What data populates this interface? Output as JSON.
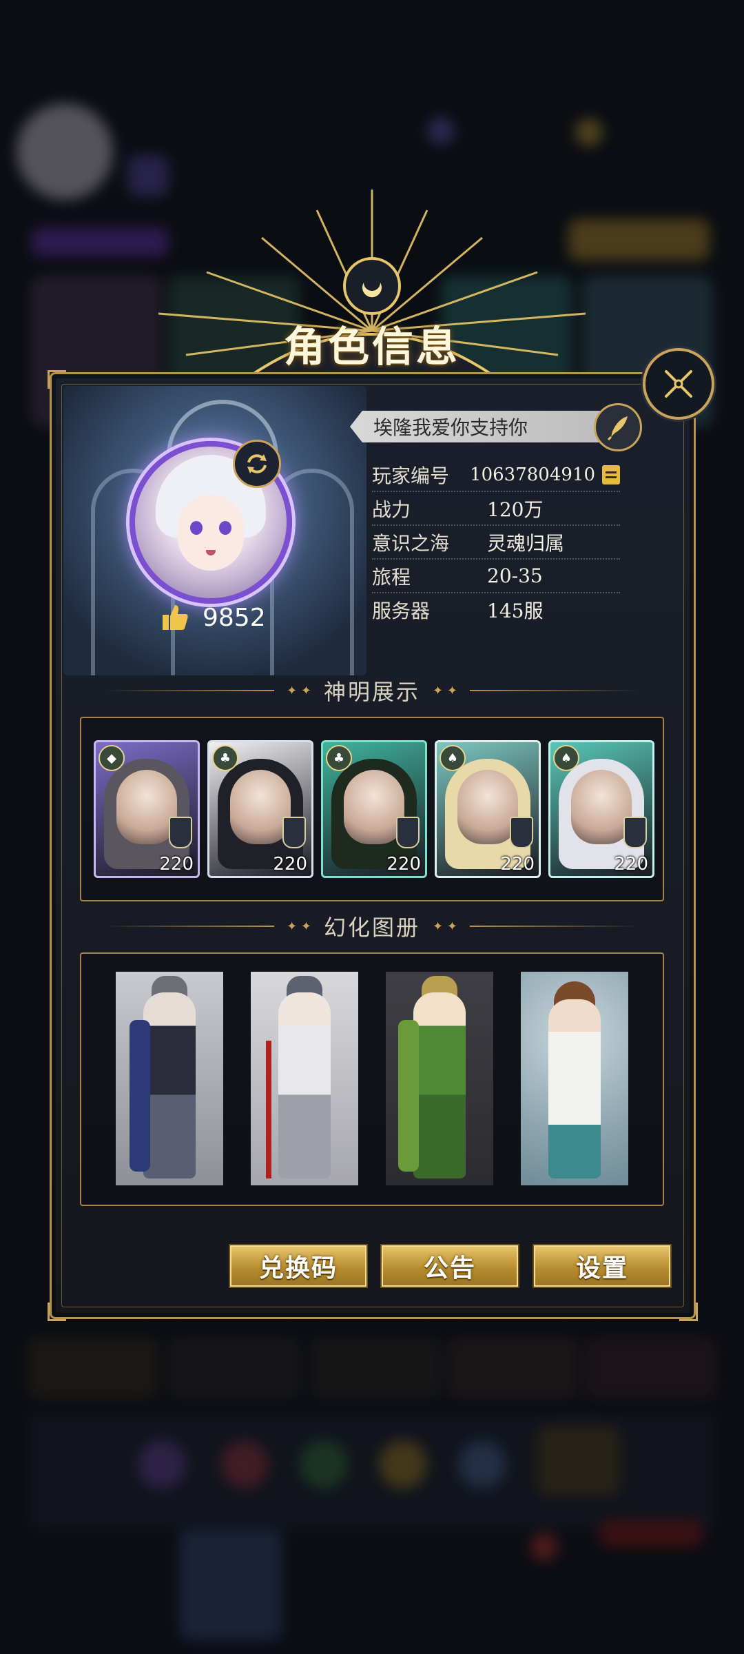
{
  "title": "角色信息",
  "player": {
    "name": "埃隆我爱你支持你",
    "likes": "9852",
    "fields": [
      {
        "label": "玩家编号",
        "value": "10637804910"
      },
      {
        "label": "战力",
        "value": "120万"
      },
      {
        "label": "意识之海",
        "value": "灵魂归属"
      },
      {
        "label": "旅程",
        "value": "20-35"
      },
      {
        "label": "服务器",
        "value": "145服"
      }
    ]
  },
  "sections": {
    "gods": "神明展示",
    "atlas": "幻化图册"
  },
  "god_cards": [
    {
      "level": "220",
      "suit": "diamond-icon",
      "frame": "#c8b8f0",
      "bg": "#7b6cc7",
      "hair": "#5a5660"
    },
    {
      "level": "220",
      "suit": "club-icon",
      "frame": "#d8e0ec",
      "bg": "#f0f0f4",
      "hair": "#202028"
    },
    {
      "level": "220",
      "suit": "club-icon",
      "frame": "#7fe0cc",
      "bg": "#3fb39c",
      "hair": "#1e2a1e"
    },
    {
      "level": "220",
      "suit": "spade-icon",
      "frame": "#e0f0ec",
      "bg": "#7cc7c0",
      "hair": "#e8d9a8"
    },
    {
      "level": "220",
      "suit": "spade-icon",
      "frame": "#c0f0e8",
      "bg": "#57c7b8",
      "hair": "#e2e2ea"
    }
  ],
  "buttons": {
    "redeem": "兑换码",
    "notice": "公告",
    "settings": "设置"
  },
  "colors": {
    "gold": "#c9a45a",
    "panel": "#181b24",
    "button": "#d2a94a"
  }
}
